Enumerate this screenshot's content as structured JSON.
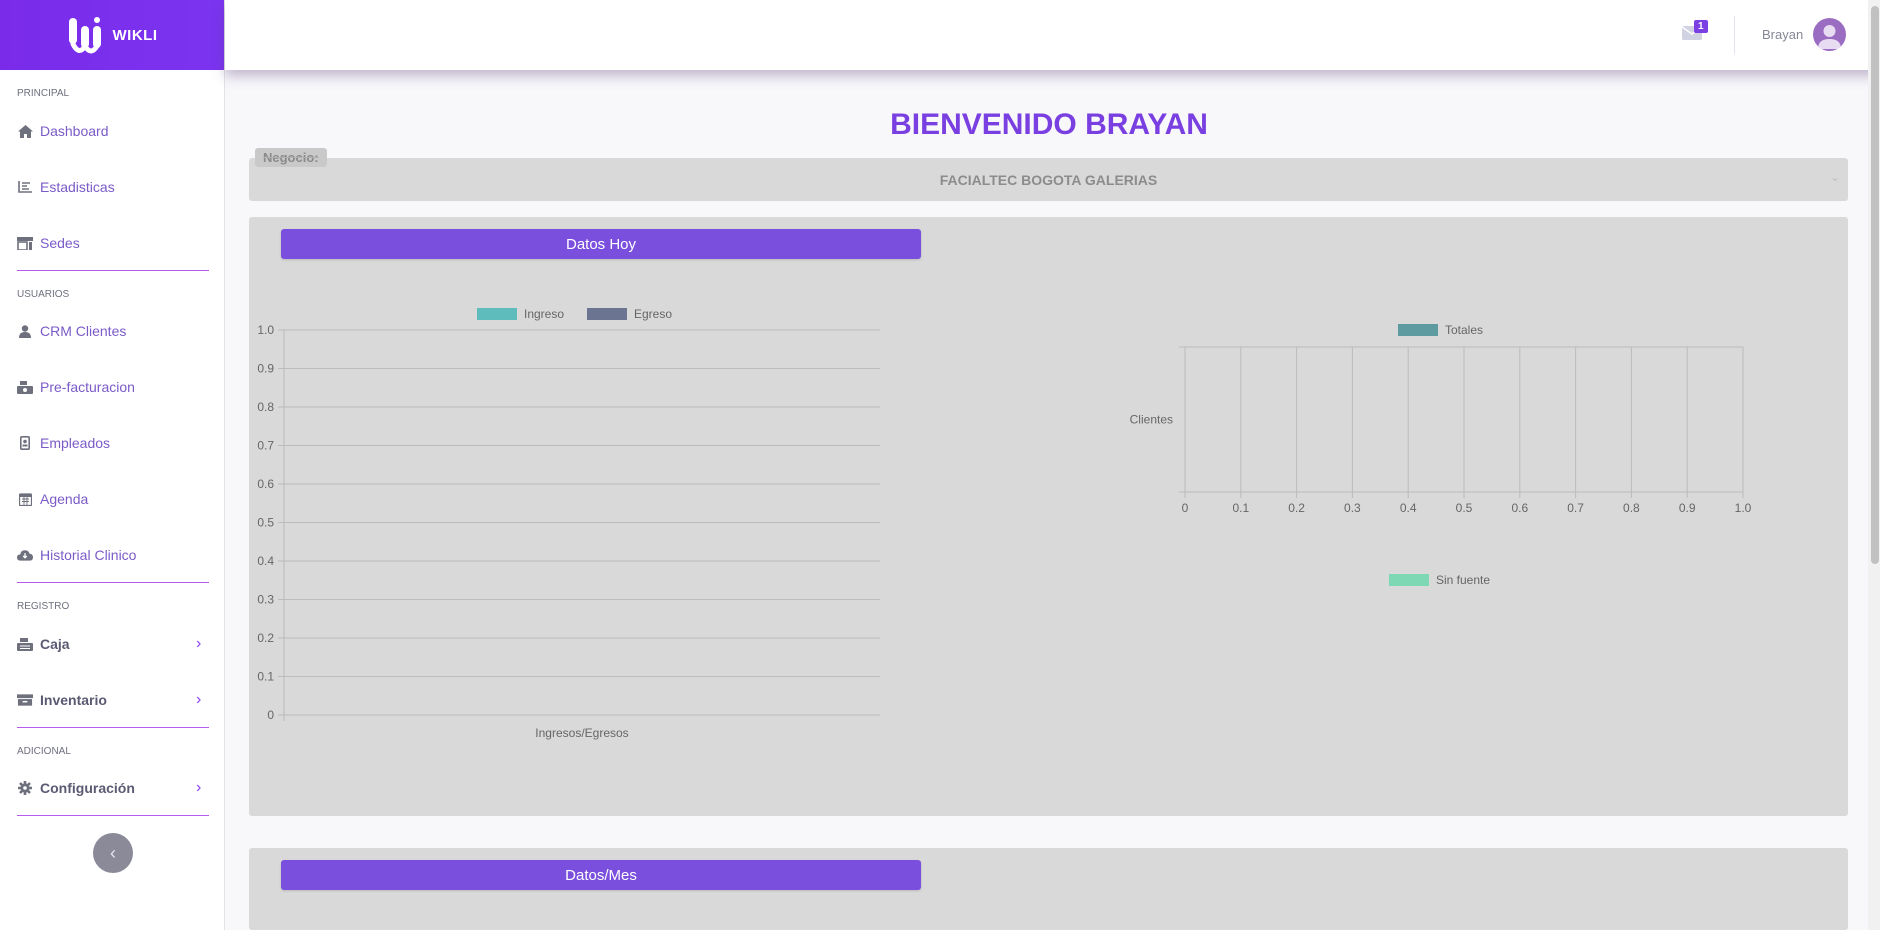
{
  "sidebar": {
    "brand": "WIKLI",
    "sections": {
      "principal": "PRINCIPAL",
      "usuarios": "USUARIOS",
      "registro": "REGISTRO",
      "adicional": "ADICIONAL"
    },
    "items": {
      "dashboard": "Dashboard",
      "estadisticas": "Estadisticas",
      "sedes": "Sedes",
      "crm": "CRM Clientes",
      "prefacturacion": "Pre-facturacion",
      "empleados": "Empleados",
      "agenda": "Agenda",
      "historial": "Historial Clinico",
      "caja": "Caja",
      "inventario": "Inventario",
      "configuracion": "Configuración"
    }
  },
  "topbar": {
    "message_count": "1",
    "user_name": "Brayan"
  },
  "main": {
    "welcome": "BIENVENIDO BRAYAN",
    "negocio_label": "Negocio:",
    "negocio_value": "FACIALTEC BOGOTA GALERIAS",
    "card1_title": "Datos Hoy",
    "card2_title": "Datos/Mes"
  },
  "chart_data": [
    {
      "type": "bar",
      "categories": [
        "Ingresos/Egresos"
      ],
      "series": [
        {
          "name": "Ingreso",
          "values": [],
          "color": "#5fbcbc"
        },
        {
          "name": "Egreso",
          "values": [],
          "color": "#6b7592"
        }
      ],
      "y_ticks": [
        "1.0",
        "0.9",
        "0.8",
        "0.7",
        "0.6",
        "0.5",
        "0.4",
        "0.3",
        "0.2",
        "0.1",
        "0"
      ],
      "ylim": [
        0,
        1
      ],
      "grid": true,
      "legend": "top"
    },
    {
      "type": "bar",
      "orientation": "horizontal",
      "categories": [
        "Clientes"
      ],
      "series": [
        {
          "name": "Totales",
          "values": [],
          "color": "#5e9ba0"
        }
      ],
      "x_ticks": [
        "0",
        "0.1",
        "0.2",
        "0.3",
        "0.4",
        "0.5",
        "0.6",
        "0.7",
        "0.8",
        "0.9",
        "1.0"
      ],
      "xlim": [
        0,
        1
      ],
      "grid": true,
      "legend": "top"
    },
    {
      "type": "pie",
      "series": [
        {
          "name": "Sin fuente",
          "values": [],
          "color": "#7fd8b4"
        }
      ],
      "legend": "top"
    }
  ]
}
